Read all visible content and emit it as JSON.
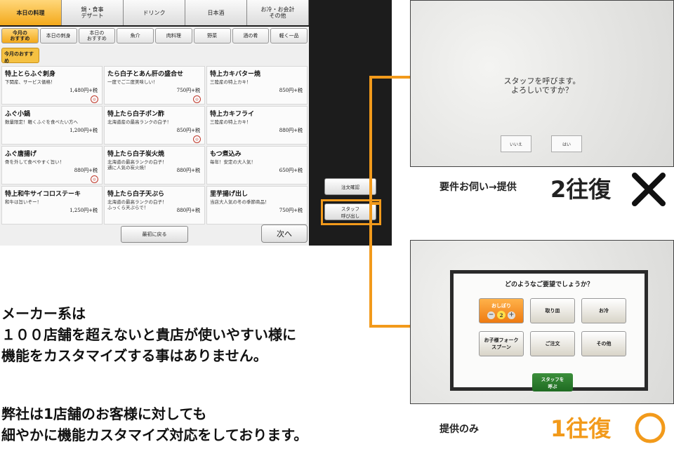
{
  "colors": {
    "accent": "#f29a1b",
    "dark": "#1c1c1c",
    "call_green": "#1f6b22"
  },
  "tablet": {
    "category_tabs": [
      {
        "label": "本日の料理",
        "active": true
      },
      {
        "label": "鍋・食事\nデザート",
        "active": false
      },
      {
        "label": "ドリンク",
        "active": false
      },
      {
        "label": "日本酒",
        "active": false
      },
      {
        "label": "お冷・お会計\nその他",
        "active": false
      }
    ],
    "sub_tabs": [
      {
        "label": "今月の\nおすすめ",
        "active": true
      },
      {
        "label": "本日の刺身",
        "active": false
      },
      {
        "label": "本日の\nおすすめ",
        "active": false
      },
      {
        "label": "魚介",
        "active": false
      },
      {
        "label": "肉料理",
        "active": false
      },
      {
        "label": "野菜",
        "active": false
      },
      {
        "label": "酒の肴",
        "active": false
      },
      {
        "label": "軽く一品",
        "active": false
      }
    ],
    "section_label": "今月のおすすめ",
    "items": [
      {
        "name": "特上とらふぐ刺身",
        "desc": "下関産、サービス価格！",
        "price": "1,480円+税",
        "stamp": true
      },
      {
        "name": "たら白子とあん肝の盛合せ",
        "desc": "一度でご二度美味しい！",
        "price": "750円+税",
        "stamp": true
      },
      {
        "name": "特上カキバター焼",
        "desc": "三陸産の特上カキ！",
        "price": "850円+税",
        "stamp": false
      },
      {
        "name": "ふぐ小鍋",
        "desc": "数量限定！軽くふぐを食べたい方へ",
        "price": "1,200円+税",
        "stamp": false
      },
      {
        "name": "特上たら白子ポン酢",
        "desc": "北海道産の最高ランクの白子！",
        "price": "850円+税",
        "stamp": true
      },
      {
        "name": "特上カキフライ",
        "desc": "三陸産の特上カキ！",
        "price": "880円+税",
        "stamp": false
      },
      {
        "name": "ふぐ唐揚げ",
        "desc": "骨を外して食べやすく旨い！",
        "price": "880円+税",
        "stamp": true
      },
      {
        "name": "特上たら白子炭火焼",
        "desc": "北海道の最高ランクの白子！\n通に人気の炭火焼！",
        "price": "880円+税",
        "stamp": false
      },
      {
        "name": "もつ煮込み",
        "desc": "毎年！安定の大人気！",
        "price": "650円+税",
        "stamp": false
      },
      {
        "name": "特上和牛サイコロステーキ",
        "desc": "和牛は旨いぞー！",
        "price": "1,250円+税",
        "stamp": false
      },
      {
        "name": "特上たら白子天ぷら",
        "desc": "北海道の最高ランクの白子！\nふっくら天ぷらで！",
        "price": "880円+税",
        "stamp": false
      },
      {
        "name": "里芋揚げ出し",
        "desc": "当店大人気の冬の季節商品！",
        "price": "750円+税",
        "stamp": false
      }
    ],
    "btn_first": "最初に戻る",
    "btn_next": "次へ",
    "btn_order_check": "注文確認",
    "btn_staff_call": "スタッフ\n呼び出し",
    "stamp_text": "おすすめ"
  },
  "screen1": {
    "message": "スタッフを呼びます。\nよろしいですか？",
    "btn_no": "いいえ",
    "btn_yes": "はい",
    "caption": "要件お伺い→提供",
    "caption_big": "2往復",
    "mark_icon": "cross-mark-icon"
  },
  "screen2": {
    "title": "どのようなご要望でしょうか？",
    "options": [
      {
        "label": "おしぼり",
        "active": true,
        "count": "2"
      },
      {
        "label": "取り皿",
        "active": false
      },
      {
        "label": "お冷",
        "active": false
      },
      {
        "label": "お子様フォーク\nスプーン",
        "active": false
      },
      {
        "label": "ご注文",
        "active": false
      },
      {
        "label": "その他",
        "active": false
      }
    ],
    "btn_call": "スタッフを\n呼ぶ",
    "caption": "提供のみ",
    "caption_big": "1往復",
    "mark_icon": "circle-mark-icon"
  },
  "body": {
    "para1": "メーカー系は\n１００店舗を超えないと貴店が使いやすい様に\n機能をカスタマイズする事はありません。",
    "para2": "弊社は1店舗のお客様に対しても\n細やかに機能カスタマイズ対応をしております。"
  }
}
